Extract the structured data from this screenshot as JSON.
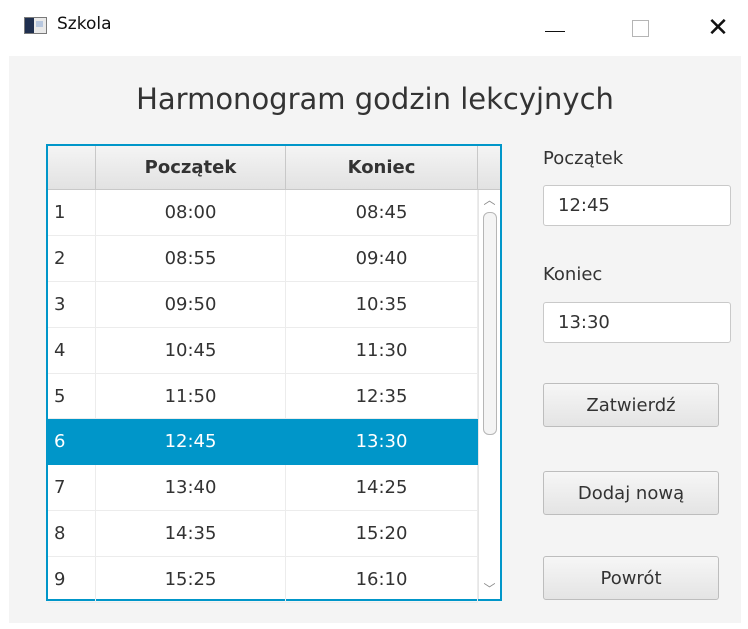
{
  "window": {
    "title": "Szkola",
    "minimize_glyph": "",
    "close_glyph": "✕"
  },
  "heading": "Harmonogram godzin lekcyjnych",
  "table": {
    "columns": [
      "",
      "Początek",
      "Koniec"
    ],
    "rows": [
      {
        "idx": "1",
        "start": "08:00",
        "end": "08:45"
      },
      {
        "idx": "2",
        "start": "08:55",
        "end": "09:40"
      },
      {
        "idx": "3",
        "start": "09:50",
        "end": "10:35"
      },
      {
        "idx": "4",
        "start": "10:45",
        "end": "11:30"
      },
      {
        "idx": "5",
        "start": "11:50",
        "end": "12:35"
      },
      {
        "idx": "6",
        "start": "12:45",
        "end": "13:30"
      },
      {
        "idx": "7",
        "start": "13:40",
        "end": "14:25"
      },
      {
        "idx": "8",
        "start": "14:35",
        "end": "15:20"
      },
      {
        "idx": "9",
        "start": "15:25",
        "end": "16:10"
      }
    ],
    "selected_index": 5
  },
  "form": {
    "start_label": "Początek",
    "start_value": "12:45",
    "end_label": "Koniec",
    "end_value": "13:30"
  },
  "buttons": {
    "confirm": "Zatwierdź",
    "add_new": "Dodaj nową",
    "back": "Powrót"
  },
  "colors": {
    "selection": "#0096c9",
    "table_border": "#0096c9"
  },
  "icons": {
    "app": "window-app-icon",
    "minimize": "minimize-icon",
    "maximize": "maximize-icon",
    "close": "close-icon",
    "scroll_up": "chevron-up-icon",
    "scroll_down": "chevron-down-icon"
  }
}
